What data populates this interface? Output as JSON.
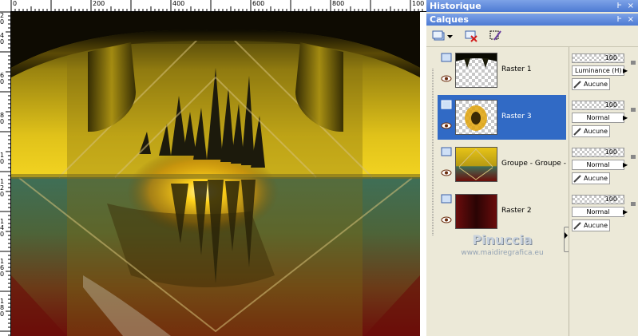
{
  "colors": {
    "title_bar": "#4d7ad3",
    "selection": "#316ac5",
    "panel_bg": "#ece9d8"
  },
  "ruler": {
    "top_labels": [
      "0",
      "200",
      "400",
      "600",
      "800",
      "100"
    ],
    "left_labels": [
      "2",
      "0",
      "4",
      "0",
      "6",
      "0",
      "8",
      "0",
      "1",
      "0",
      "1",
      "2",
      "0",
      "1",
      "4",
      "0",
      "1",
      "6",
      "0",
      "1",
      "8",
      "0"
    ]
  },
  "panels": {
    "history_title": "Historique",
    "layers_title": "Calques",
    "pin_glyph": "Ͱ",
    "close_glyph": "×"
  },
  "toolbar": {
    "new_layer_icon": "new-layer-icon",
    "dropdown_icon": "chevron-down-icon",
    "delete_icon": "delete-layer-icon",
    "edit_icon": "edit-selection-icon"
  },
  "layers": [
    {
      "name": "Raster 1",
      "opacity": "100",
      "blend": "Luminance (H)",
      "mask": "Aucune",
      "selected": false
    },
    {
      "name": "Raster 3",
      "opacity": "100",
      "blend": "Normal",
      "mask": "Aucune",
      "selected": true
    },
    {
      "name": "Groupe - Groupe -",
      "opacity": "100",
      "blend": "Normal",
      "mask": "Aucune",
      "selected": false
    },
    {
      "name": "Raster 2",
      "opacity": "100",
      "blend": "Normal",
      "mask": "Aucune",
      "selected": false
    }
  ],
  "watermark": {
    "name": "Pinuccia",
    "url": "www.maidiregrafica.eu"
  }
}
